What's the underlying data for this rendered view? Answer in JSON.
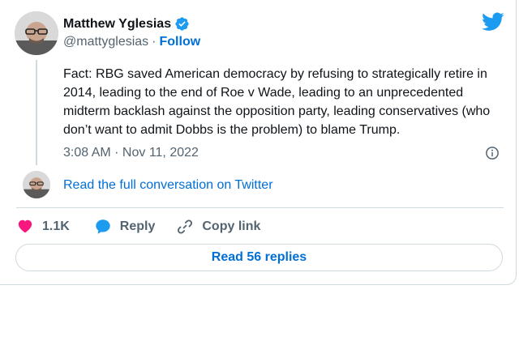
{
  "author": {
    "name": "Matthew Yglesias",
    "handle": "@mattyglesias",
    "separator": "·",
    "follow_label": "Follow",
    "verified": true
  },
  "icons": {
    "logo": "twitter-bird-icon",
    "verified": "verified-badge-icon",
    "info": "info-icon",
    "like": "heart-icon",
    "reply": "speech-bubble-icon",
    "copy": "link-icon"
  },
  "tweet": {
    "text": "Fact: RBG saved American democracy by refusing to strategically retire in 2014, leading to the end of Roe v Wade, leading to an unprecedented midterm backlash against the opposition party, leading conservatives (who don’t want to admit Dobbs is the problem) to blame Trump.",
    "timestamp": "3:08 AM · Nov 11, 2022"
  },
  "conversation_link": "Read the full conversation on Twitter",
  "actions": {
    "like_count": "1.1K",
    "reply_label": "Reply",
    "copy_label": "Copy link"
  },
  "replies_button": "Read 56 replies",
  "colors": {
    "brand": "#1d9bf0",
    "link": "#006fd6",
    "like": "#f91880",
    "text": "#0f1419",
    "muted": "#536471",
    "border": "#cfd9de"
  }
}
